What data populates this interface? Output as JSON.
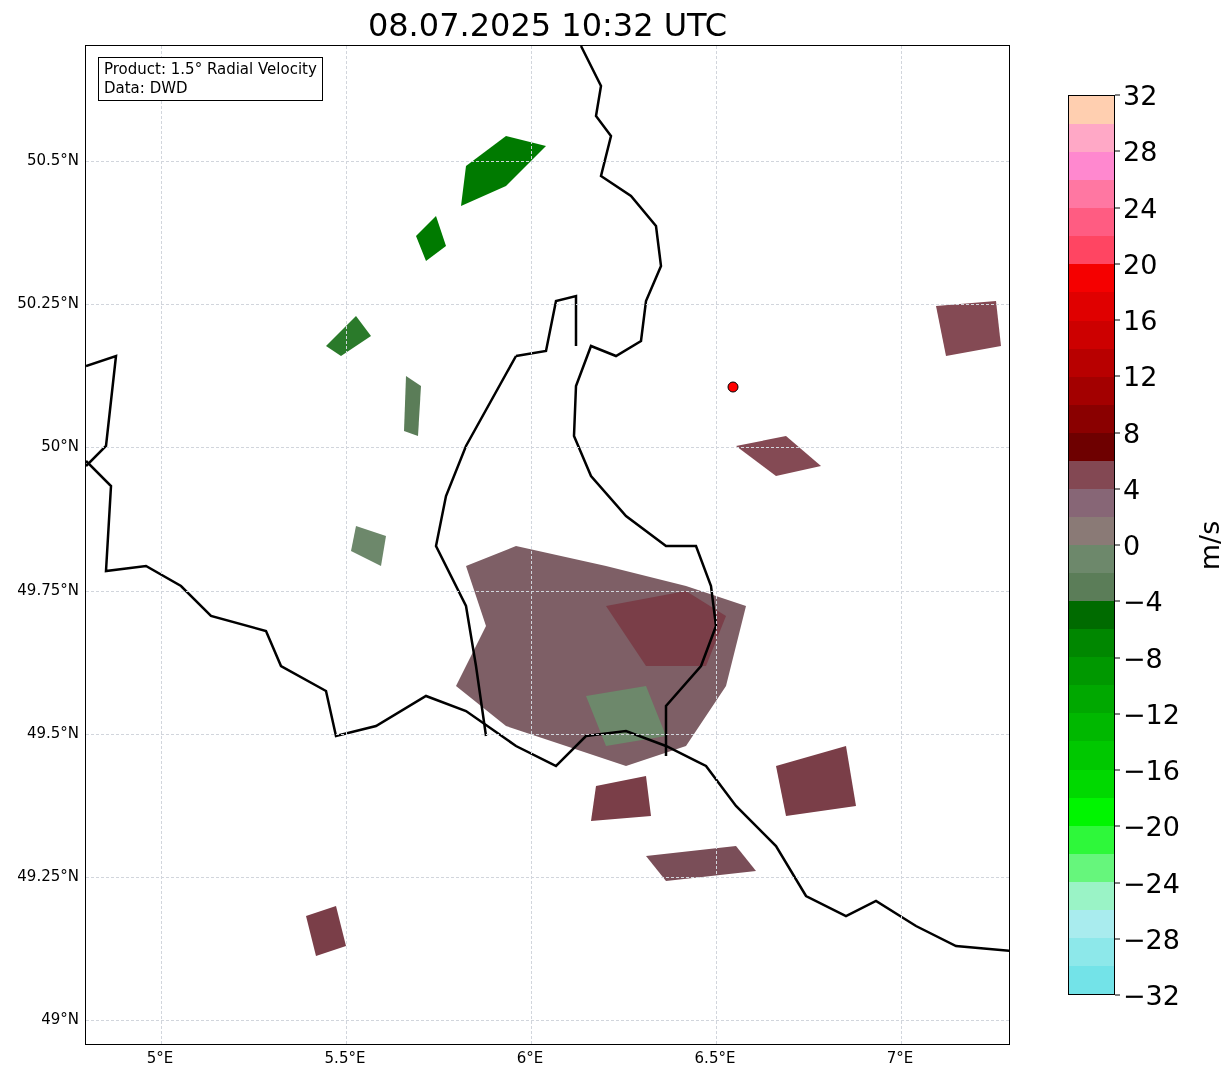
{
  "title": "08.07.2025 10:32 UTC",
  "info_box": {
    "lines": [
      "Product: 1.5° Radial Velocity",
      "Data: DWD"
    ]
  },
  "axes": {
    "y_labels": [
      "50.5°N",
      "50.25°N",
      "50°N",
      "49.75°N",
      "49.5°N",
      "49.25°N",
      "49°N"
    ],
    "x_labels": [
      "5°E",
      "5.5°E",
      "6°E",
      "6.5°E",
      "7°E"
    ]
  },
  "colorbar": {
    "label": "m/s",
    "segments": [
      {
        "color": "#ffcfb0"
      },
      {
        "color": "#ffa8c6"
      },
      {
        "color": "#ff88cf"
      },
      {
        "color": "#ff77a2"
      },
      {
        "color": "#ff5c82"
      },
      {
        "color": "#ff4562"
      },
      {
        "color": "#f50000"
      },
      {
        "color": "#e00000"
      },
      {
        "color": "#cd0000"
      },
      {
        "color": "#b80000"
      },
      {
        "color": "#a30000"
      },
      {
        "color": "#8a0000"
      },
      {
        "color": "#6e0000"
      },
      {
        "color": "#834853"
      },
      {
        "color": "#876676"
      },
      {
        "color": "#8a7a76"
      },
      {
        "color": "#6d886b"
      },
      {
        "color": "#5b7d58"
      },
      {
        "color": "#006b00"
      },
      {
        "color": "#008700"
      },
      {
        "color": "#009800"
      },
      {
        "color": "#00a800"
      },
      {
        "color": "#00b800"
      },
      {
        "color": "#00c800"
      },
      {
        "color": "#00d900"
      },
      {
        "color": "#00f500"
      },
      {
        "color": "#2ef83a"
      },
      {
        "color": "#66f67c"
      },
      {
        "color": "#9af3c6"
      },
      {
        "color": "#a9ecee"
      },
      {
        "color": "#8de8ea"
      },
      {
        "color": "#73e3e8"
      }
    ],
    "ticks": [
      "32",
      "28",
      "24",
      "20",
      "16",
      "12",
      "8",
      "4",
      "0",
      "−4",
      "−8",
      "−12",
      "−16",
      "−20",
      "−24",
      "−28",
      "−32"
    ]
  }
}
